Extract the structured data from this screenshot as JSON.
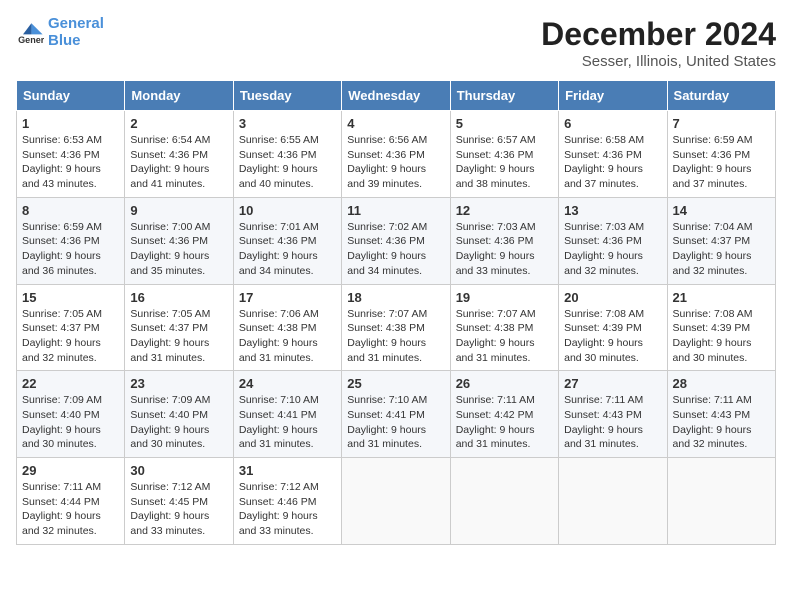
{
  "header": {
    "logo_line1": "General",
    "logo_line2": "Blue",
    "title": "December 2024",
    "subtitle": "Sesser, Illinois, United States"
  },
  "days_of_week": [
    "Sunday",
    "Monday",
    "Tuesday",
    "Wednesday",
    "Thursday",
    "Friday",
    "Saturday"
  ],
  "weeks": [
    [
      {
        "day": "1",
        "sunrise": "6:53 AM",
        "sunset": "4:36 PM",
        "daylight": "9 hours and 43 minutes."
      },
      {
        "day": "2",
        "sunrise": "6:54 AM",
        "sunset": "4:36 PM",
        "daylight": "9 hours and 41 minutes."
      },
      {
        "day": "3",
        "sunrise": "6:55 AM",
        "sunset": "4:36 PM",
        "daylight": "9 hours and 40 minutes."
      },
      {
        "day": "4",
        "sunrise": "6:56 AM",
        "sunset": "4:36 PM",
        "daylight": "9 hours and 39 minutes."
      },
      {
        "day": "5",
        "sunrise": "6:57 AM",
        "sunset": "4:36 PM",
        "daylight": "9 hours and 38 minutes."
      },
      {
        "day": "6",
        "sunrise": "6:58 AM",
        "sunset": "4:36 PM",
        "daylight": "9 hours and 37 minutes."
      },
      {
        "day": "7",
        "sunrise": "6:59 AM",
        "sunset": "4:36 PM",
        "daylight": "9 hours and 37 minutes."
      }
    ],
    [
      {
        "day": "8",
        "sunrise": "6:59 AM",
        "sunset": "4:36 PM",
        "daylight": "9 hours and 36 minutes."
      },
      {
        "day": "9",
        "sunrise": "7:00 AM",
        "sunset": "4:36 PM",
        "daylight": "9 hours and 35 minutes."
      },
      {
        "day": "10",
        "sunrise": "7:01 AM",
        "sunset": "4:36 PM",
        "daylight": "9 hours and 34 minutes."
      },
      {
        "day": "11",
        "sunrise": "7:02 AM",
        "sunset": "4:36 PM",
        "daylight": "9 hours and 34 minutes."
      },
      {
        "day": "12",
        "sunrise": "7:03 AM",
        "sunset": "4:36 PM",
        "daylight": "9 hours and 33 minutes."
      },
      {
        "day": "13",
        "sunrise": "7:03 AM",
        "sunset": "4:36 PM",
        "daylight": "9 hours and 32 minutes."
      },
      {
        "day": "14",
        "sunrise": "7:04 AM",
        "sunset": "4:37 PM",
        "daylight": "9 hours and 32 minutes."
      }
    ],
    [
      {
        "day": "15",
        "sunrise": "7:05 AM",
        "sunset": "4:37 PM",
        "daylight": "9 hours and 32 minutes."
      },
      {
        "day": "16",
        "sunrise": "7:05 AM",
        "sunset": "4:37 PM",
        "daylight": "9 hours and 31 minutes."
      },
      {
        "day": "17",
        "sunrise": "7:06 AM",
        "sunset": "4:38 PM",
        "daylight": "9 hours and 31 minutes."
      },
      {
        "day": "18",
        "sunrise": "7:07 AM",
        "sunset": "4:38 PM",
        "daylight": "9 hours and 31 minutes."
      },
      {
        "day": "19",
        "sunrise": "7:07 AM",
        "sunset": "4:38 PM",
        "daylight": "9 hours and 31 minutes."
      },
      {
        "day": "20",
        "sunrise": "7:08 AM",
        "sunset": "4:39 PM",
        "daylight": "9 hours and 30 minutes."
      },
      {
        "day": "21",
        "sunrise": "7:08 AM",
        "sunset": "4:39 PM",
        "daylight": "9 hours and 30 minutes."
      }
    ],
    [
      {
        "day": "22",
        "sunrise": "7:09 AM",
        "sunset": "4:40 PM",
        "daylight": "9 hours and 30 minutes."
      },
      {
        "day": "23",
        "sunrise": "7:09 AM",
        "sunset": "4:40 PM",
        "daylight": "9 hours and 30 minutes."
      },
      {
        "day": "24",
        "sunrise": "7:10 AM",
        "sunset": "4:41 PM",
        "daylight": "9 hours and 31 minutes."
      },
      {
        "day": "25",
        "sunrise": "7:10 AM",
        "sunset": "4:41 PM",
        "daylight": "9 hours and 31 minutes."
      },
      {
        "day": "26",
        "sunrise": "7:11 AM",
        "sunset": "4:42 PM",
        "daylight": "9 hours and 31 minutes."
      },
      {
        "day": "27",
        "sunrise": "7:11 AM",
        "sunset": "4:43 PM",
        "daylight": "9 hours and 31 minutes."
      },
      {
        "day": "28",
        "sunrise": "7:11 AM",
        "sunset": "4:43 PM",
        "daylight": "9 hours and 32 minutes."
      }
    ],
    [
      {
        "day": "29",
        "sunrise": "7:11 AM",
        "sunset": "4:44 PM",
        "daylight": "9 hours and 32 minutes."
      },
      {
        "day": "30",
        "sunrise": "7:12 AM",
        "sunset": "4:45 PM",
        "daylight": "9 hours and 33 minutes."
      },
      {
        "day": "31",
        "sunrise": "7:12 AM",
        "sunset": "4:46 PM",
        "daylight": "9 hours and 33 minutes."
      },
      null,
      null,
      null,
      null
    ]
  ],
  "labels": {
    "sunrise": "Sunrise:",
    "sunset": "Sunset:",
    "daylight": "Daylight:"
  }
}
